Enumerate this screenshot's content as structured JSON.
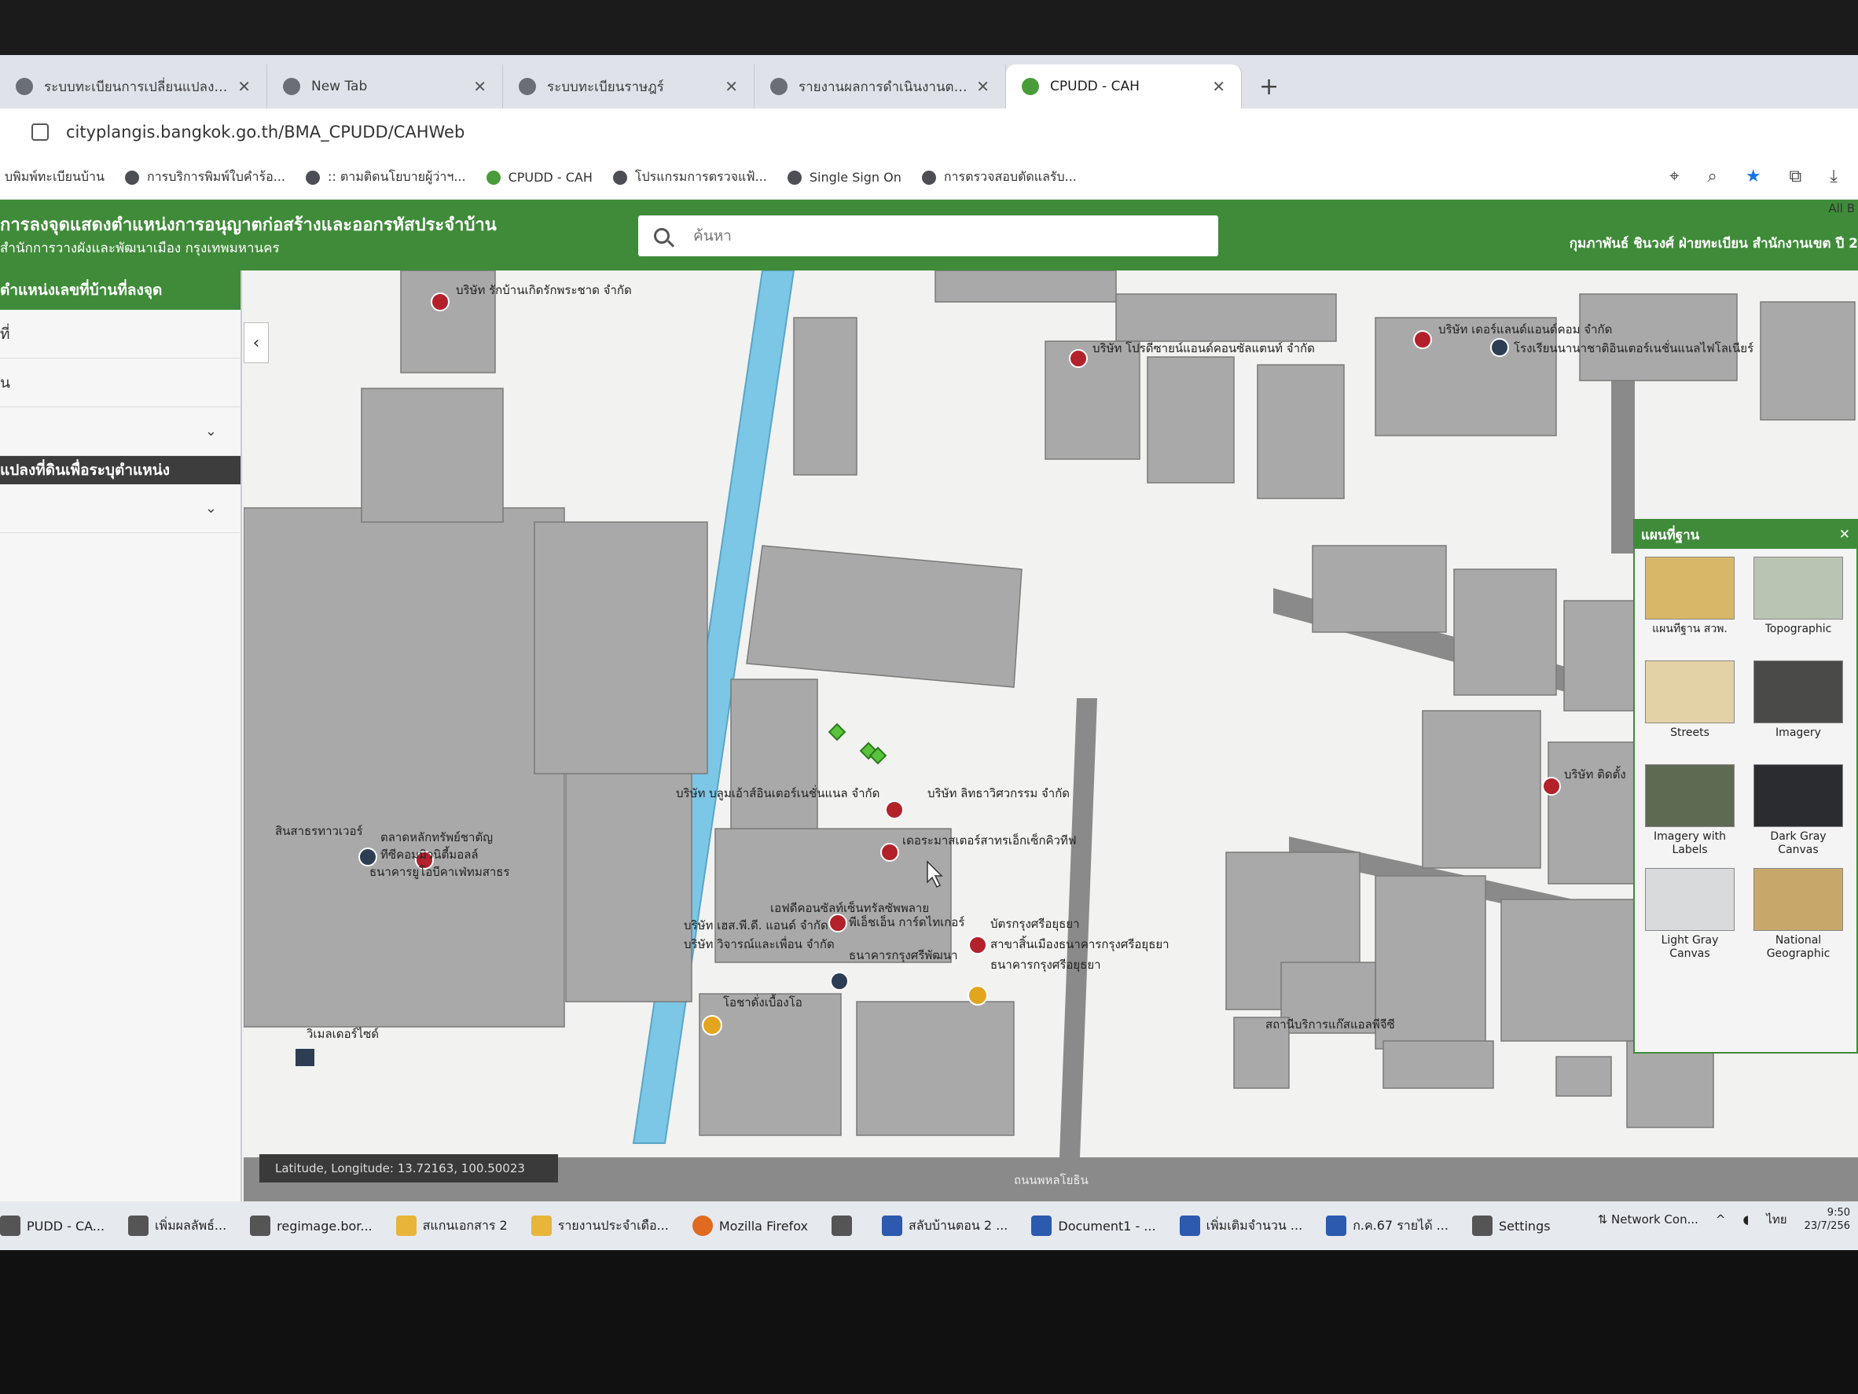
{
  "tabs": [
    {
      "label": "ระบบทะเบียนการเปลี่ยนแปลงบ้านเลขที่บ้าน",
      "active": false
    },
    {
      "label": "New Tab",
      "active": false
    },
    {
      "label": "ระบบทะเบียนราษฎร์",
      "active": false
    },
    {
      "label": "รายงานผลการดำเนินงานตาม KRs",
      "active": false
    },
    {
      "label": "CPUDD - CAH",
      "active": true
    }
  ],
  "new_tab_glyph": "+",
  "address": {
    "url": "cityplangis.bangkok.go.th/BMA_CPUDD/CAHWeb"
  },
  "bookmarks": [
    "บพิมพ์ทะเบียนบ้าน",
    "การบริการพิมพ์ใบคำร้อ...",
    ":: ตามติดนโยบายผู้ว่าฯ...",
    "CPUDD - CAH",
    "โปรแกรมการตรวจแฟ้...",
    "Single Sign On",
    "การตรวจสอบตัดแลรับ..."
  ],
  "all_bookmarks": "All B",
  "app": {
    "title": "การลงจุดแสดงตำแหน่งการอนุญาตก่อสร้างและออกรหัสประจำบ้าน",
    "subtitle": "สำนักการวางผังและพัฒนาเมือง กรุงเทพมหานคร",
    "search_placeholder": "ค้นหา",
    "user": "กุมภาพันธ์ ชินวงศ์ ฝ่ายทะเบียน สำนักงานเขต ปี 2"
  },
  "left_panel": {
    "header": "ตำแหน่งเลขที่บ้านที่ลงจุด",
    "rows": [
      "ที่",
      "น"
    ],
    "section": "แปลงที่ดินเพื่อระบุตำแหน่ง"
  },
  "map_labels": {
    "company_1": "บริษัท รักบ้านเกิดรักพระชาด จำกัด",
    "company_2": "บริษัท โปรดีซายน์แอนด์คอนซัลแตนท์ จำกัด",
    "company_3": "บริษัท เดอร์แลนด์แอนด์คอม จำกัด",
    "school": "โรงเรียนนานาชาติอินเตอร์เนชั่นแนลไฟโลเนียร์",
    "company_4": "บริษัท ติดตั้ง",
    "company_5": "บริษัท บลูมเอ้าส์อินเตอร์เนชั่นแนล จำกัด",
    "company_6": "บริษัท ลิทธาวิศวกรรม จำกัด",
    "company_7": "เดอระมาสเตอร์สาทรเอ็กเซ็กคิวทีฟ",
    "tower": "สินสาธรทาวเวอร์",
    "bank_1": "ตลาดหลักทรัพย์ชาตัญ",
    "bank_2": "ทีซีคอมมิวนิตี้มอลล์",
    "bank_3": "ธนาคารยูโอบีคาเฟ่ทมสาธร",
    "company_8": "เอฟดีคอนซัลท์เซ็นทรัลซัพพลาย",
    "company_9": "บริษัท เฮส.พี.ดี. แอนด์ จำกัด",
    "company_10": "บริษัท วิจารณ์และเพื่อน จำกัด",
    "company_11": "พีเอ็ชเอ็น การ์ดไทเกอร์",
    "bank_4": "ธนาคารกรุงศรีพัฒนา",
    "company_12": "บัตรกรุงศรีอยุธยา",
    "bank_5": "สาขาสิ้นเมืองธนาคารกรุงศรีอยุธยา",
    "bank_6": "ธนาคารกรุงศรีอยุธยา",
    "cafe": "โอชาดั่งเบื้องโอ",
    "station": "สถานีบริการแก๊สแอลพีจีซี",
    "mall": "วิเมลเดอร์ไซด์",
    "road": "ถนนพหลโยธิน"
  },
  "coordinate_readout": "Latitude, Longitude: 13.72163, 100.50023",
  "basemap": {
    "title": "แผนที่ฐาน",
    "items": [
      {
        "label": "แผนที่ฐาน สวพ.",
        "color": "#d7b868"
      },
      {
        "label": "Topographic",
        "color": "#b9c4b3"
      },
      {
        "label": "Streets",
        "color": "#e3d2a6"
      },
      {
        "label": "Imagery",
        "color": "#4a4a48"
      },
      {
        "label": "Imagery with Labels",
        "color": "#5f6a52"
      },
      {
        "label": "Dark Gray Canvas",
        "color": "#2b2c30"
      },
      {
        "label": "Light Gray Canvas",
        "color": "#d9dadc"
      },
      {
        "label": "National Geographic",
        "color": "#c8a86a"
      }
    ]
  },
  "taskbar": [
    {
      "label": "PUDD - CA...",
      "kind": "web"
    },
    {
      "label": "เพิ่มผลลัพธ์...",
      "kind": "web"
    },
    {
      "label": "regimage.bor...",
      "kind": "web"
    },
    {
      "label": "สแกนเอกสาร 2",
      "kind": "folder"
    },
    {
      "label": "รายงานประจำเดือ...",
      "kind": "folder"
    },
    {
      "label": "Mozilla Firefox",
      "kind": "ff"
    },
    {
      "label": "",
      "kind": "app"
    },
    {
      "label": "สลับบ้านตอน 2 ...",
      "kind": "word"
    },
    {
      "label": "Document1 - ...",
      "kind": "word"
    },
    {
      "label": "เพิ่มเติมจำนวน ...",
      "kind": "word"
    },
    {
      "label": "ก.ค.67 รายได้ ...",
      "kind": "word"
    },
    {
      "label": "Settings",
      "kind": "app"
    }
  ],
  "tray": {
    "network": "Network Con...",
    "lang": "ไทย",
    "time": "9:50",
    "date": "23/7/256"
  },
  "colors": {
    "brand_green": "#3f8b39",
    "canal": "#7cc6e6",
    "building": "#a9a9a9",
    "road": "#8a8a8a"
  }
}
